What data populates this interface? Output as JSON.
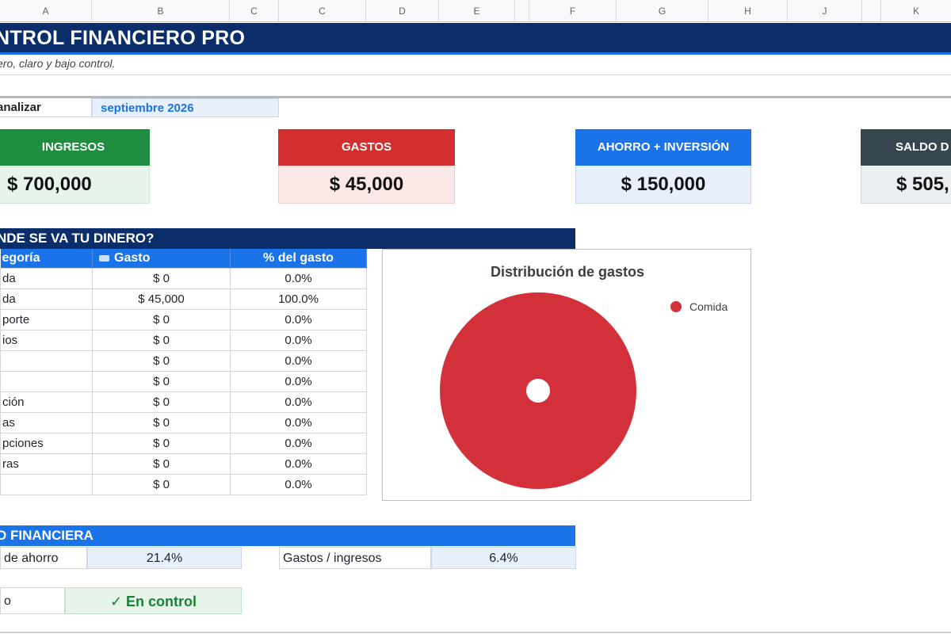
{
  "colors": {
    "title_band": "#0b2e6b",
    "accent_blue": "#1a73e8",
    "ingresos": "#1e8e3e",
    "gastos": "#d32f2f",
    "ahorro": "#1a73e8",
    "saldo": "#37474f",
    "pie": "#d3313a"
  },
  "columns": [
    "A",
    "B",
    "C",
    "C",
    "D",
    "E",
    "F",
    "G",
    "H",
    "J",
    "K"
  ],
  "title": "NTROL FINANCIERO PRO",
  "subtitle": "ero, claro y bajo control.",
  "month": {
    "label": "analizar",
    "value": "septiembre 2026"
  },
  "cards": {
    "ingresos": {
      "label": "INGRESOS",
      "value": "$ 700,000"
    },
    "gastos": {
      "label": "GASTOS",
      "value": "$ 45,000"
    },
    "ahorro": {
      "label": "AHORRO + INVERSIÓN",
      "value": "$ 150,000"
    },
    "saldo": {
      "label": "SALDO D",
      "value": "$ 505,"
    }
  },
  "breakdown": {
    "section_title": "NDE SE VA TU DINERO?",
    "headers": {
      "category": "egoría",
      "amount": "Gasto",
      "percent": "% del gasto"
    },
    "rows": [
      {
        "category": "da",
        "amount": "$ 0",
        "percent": "0.0%"
      },
      {
        "category": "da",
        "amount": "$ 45,000",
        "percent": "100.0%"
      },
      {
        "category": "porte",
        "amount": "$ 0",
        "percent": "0.0%"
      },
      {
        "category": "ios",
        "amount": "$ 0",
        "percent": "0.0%"
      },
      {
        "category": "",
        "amount": "$ 0",
        "percent": "0.0%"
      },
      {
        "category": "",
        "amount": "$ 0",
        "percent": "0.0%"
      },
      {
        "category": "ción",
        "amount": "$ 0",
        "percent": "0.0%"
      },
      {
        "category": "as",
        "amount": "$ 0",
        "percent": "0.0%"
      },
      {
        "category": "pciones",
        "amount": "$ 0",
        "percent": "0.0%"
      },
      {
        "category": "ras",
        "amount": "$ 0",
        "percent": "0.0%"
      },
      {
        "category": "",
        "amount": "$ 0",
        "percent": "0.0%"
      }
    ]
  },
  "chart_data": {
    "type": "pie",
    "title": "Distribución de gastos",
    "legend_position": "top-right",
    "slices": [
      {
        "label": "Comida",
        "value": 45000,
        "percent": 100.0,
        "color": "#d3313a"
      }
    ]
  },
  "health": {
    "section_title": "D FINANCIERA",
    "savings_label": "de ahorro",
    "savings_value": "21.4%",
    "ratio_label": "Gastos / ingresos",
    "ratio_value": "6.4%",
    "status_label": "o",
    "status_value": "✓ En control"
  }
}
